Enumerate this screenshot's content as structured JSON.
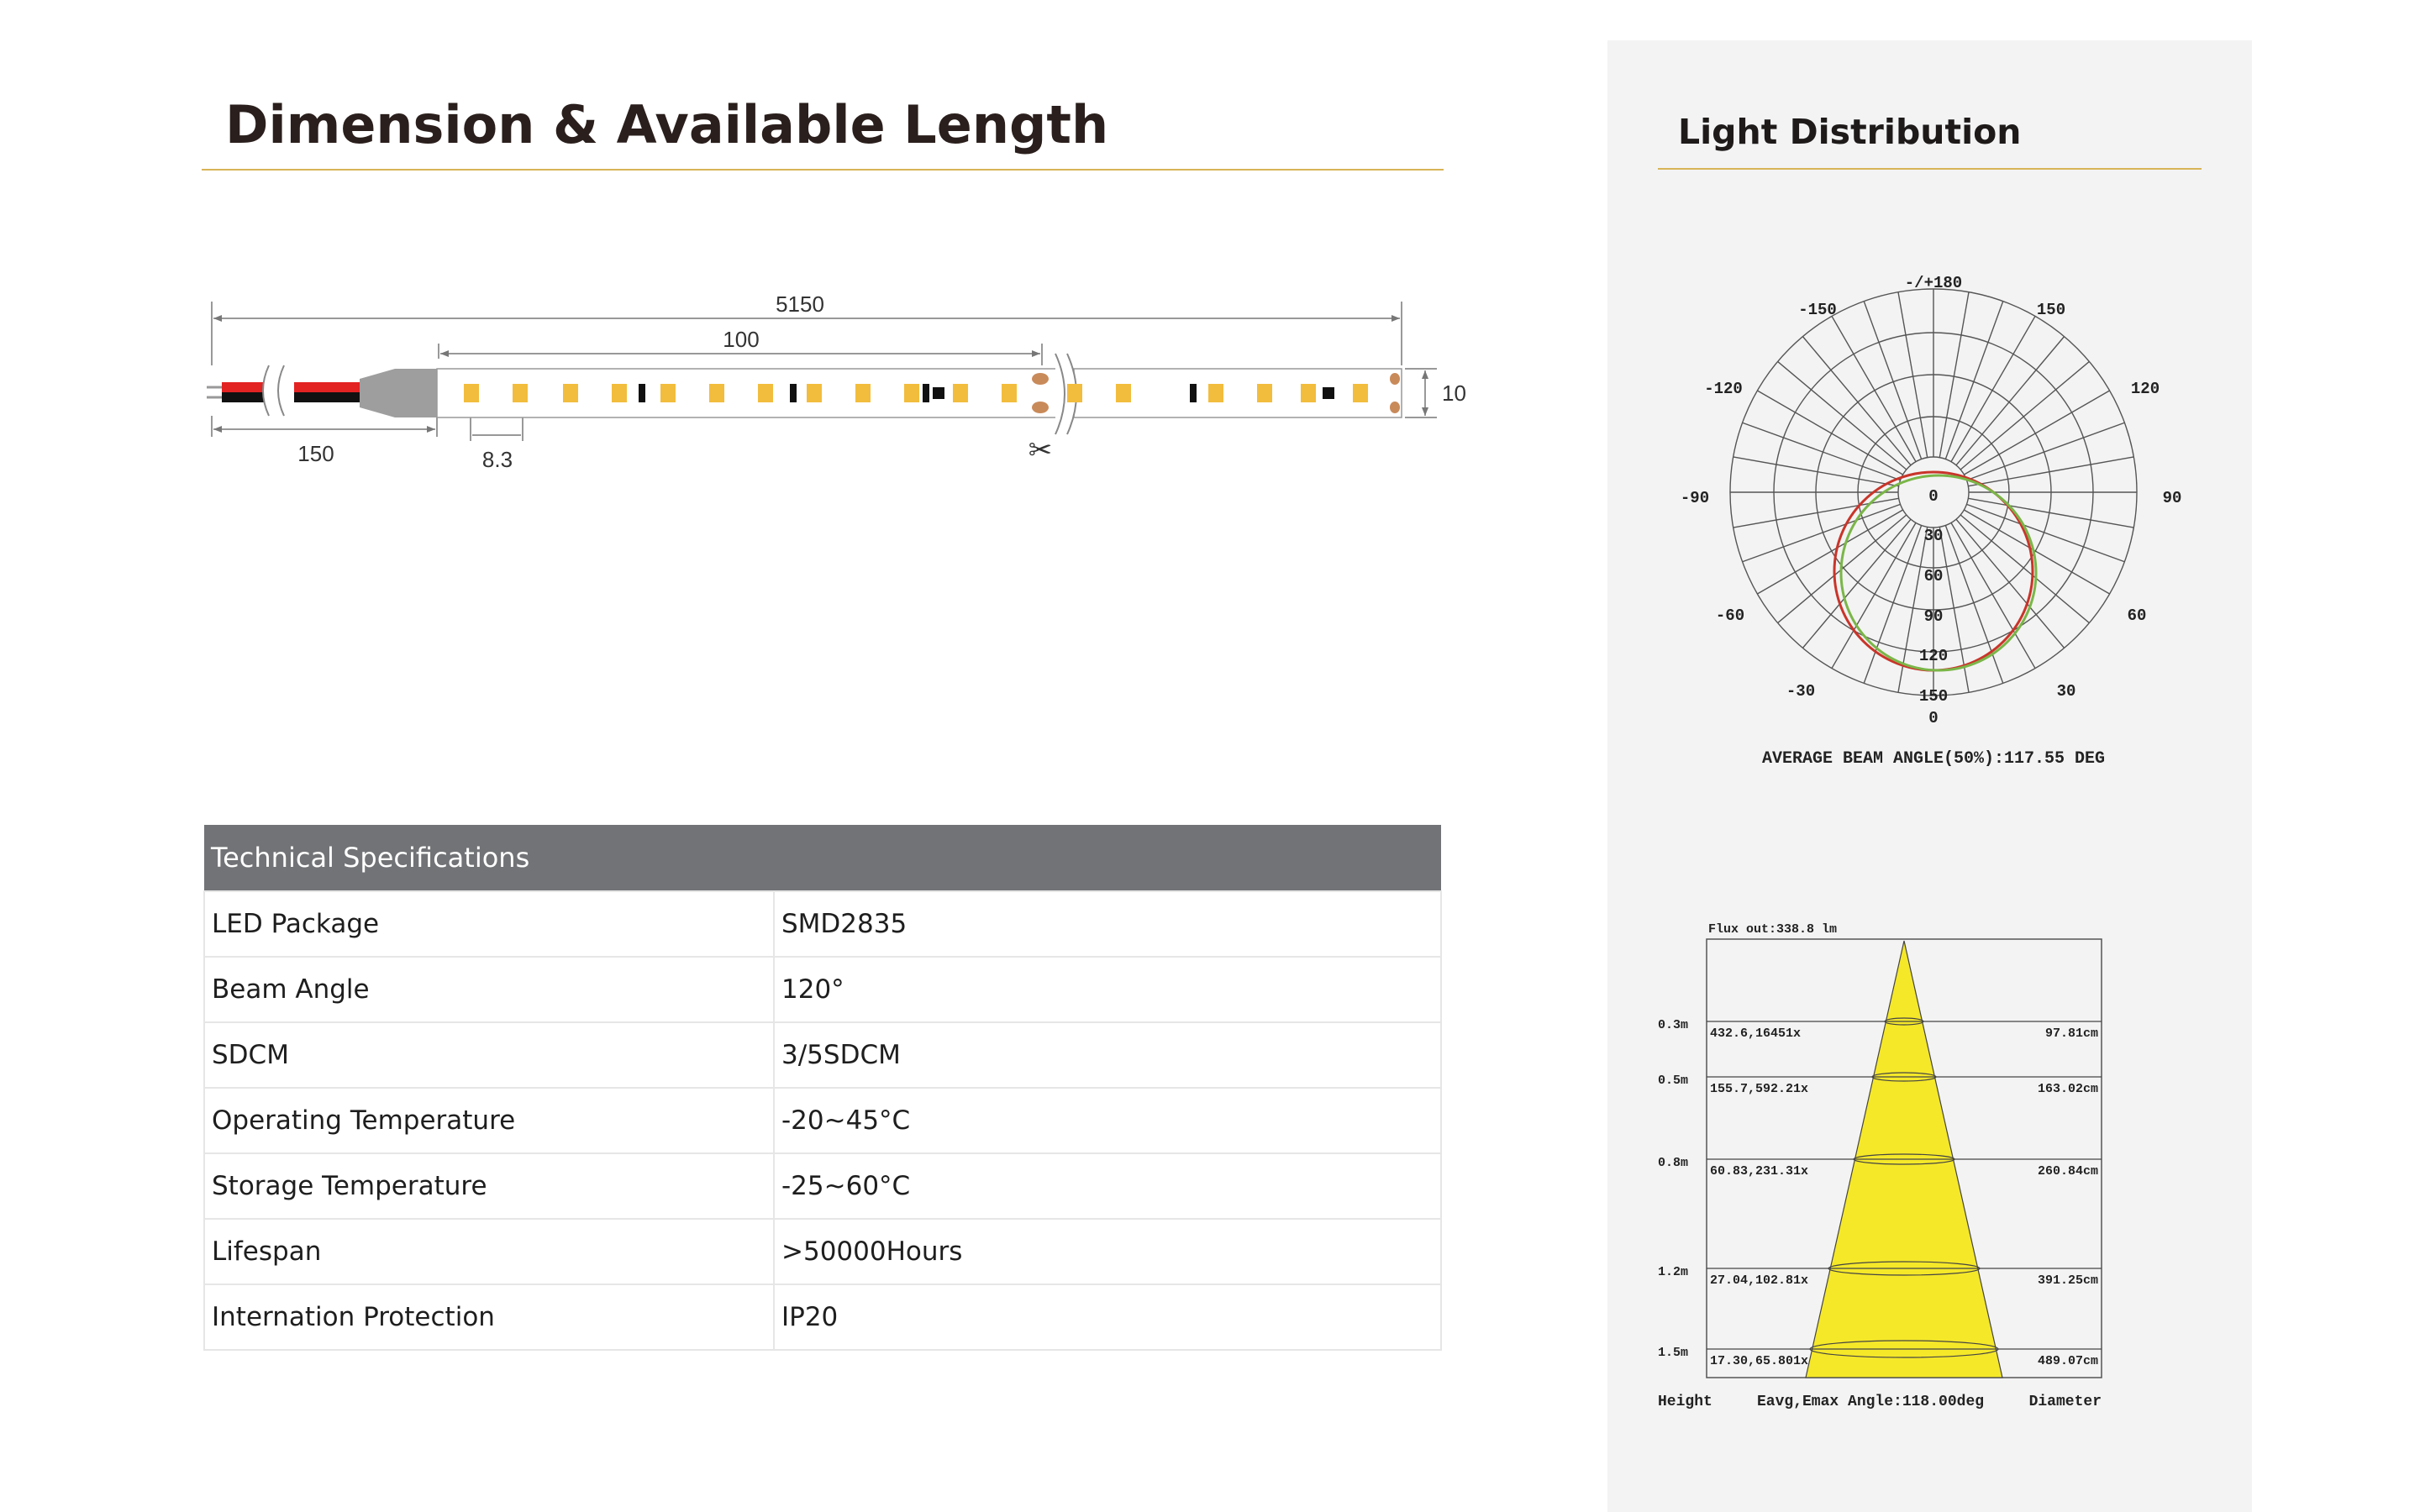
{
  "dimension": {
    "title": "Dimension & Available Length",
    "labels": {
      "total": "5150",
      "section": "100",
      "lead": "150",
      "pitch": "8.3",
      "width": "10"
    }
  },
  "specs": {
    "header": "Technical Specifications",
    "rows": [
      {
        "name": "LED Package",
        "value": "SMD2835"
      },
      {
        "name": "Beam Angle",
        "value": "120°"
      },
      {
        "name": "SDCM",
        "value": "3/5SDCM"
      },
      {
        "name": "Operating Temperature",
        "value": "-20~45°C"
      },
      {
        "name": "Storage Temperature",
        "value": "-25~60°C"
      },
      {
        "name": "Lifespan",
        "value": ">50000Hours"
      },
      {
        "name": "Internation Protection",
        "value": "IP20"
      }
    ]
  },
  "light": {
    "title": "Light Distribution",
    "polar": {
      "angle_labels": {
        "top": "-/+180",
        "m150": "-150",
        "p150": "150",
        "m120": "-120",
        "p120": "120",
        "m90": "-90",
        "p90": "90",
        "m60": "-60",
        "p60": "60",
        "m30": "-30",
        "p30": "30",
        "bottom": "0"
      },
      "radial_labels": [
        "0",
        "30",
        "60",
        "90",
        "120",
        "150"
      ],
      "caption": "AVERAGE BEAM ANGLE(50%):117.55 DEG",
      "colors": {
        "curve1": "#c9352a",
        "curve2": "#7ab648"
      }
    },
    "beam": {
      "flux": "Flux out:338.8 lm",
      "rows": [
        {
          "height": "0.3m",
          "lux": "432.6,16451x",
          "diameter": "97.81cm"
        },
        {
          "height": "0.5m",
          "lux": "155.7,592.21x",
          "diameter": "163.02cm"
        },
        {
          "height": "0.8m",
          "lux": "60.83,231.31x",
          "diameter": "260.84cm"
        },
        {
          "height": "1.2m",
          "lux": "27.04,102.81x",
          "diameter": "391.25cm"
        },
        {
          "height": "1.5m",
          "lux": "17.30,65.801x",
          "diameter": "489.07cm"
        }
      ],
      "footer": {
        "height": "Height",
        "angle": "Eavg,Emax Angle:118.00deg",
        "diameter": "Diameter"
      },
      "colors": {
        "cone": "#f5e829"
      }
    }
  }
}
